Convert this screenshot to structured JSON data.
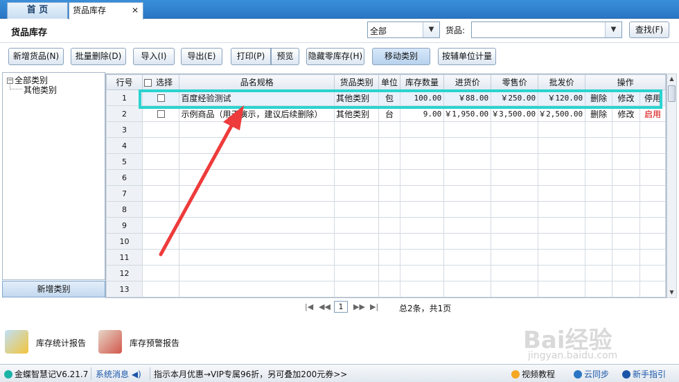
{
  "tabs": {
    "home": "首 页",
    "active": "货品库存",
    "close": "✕"
  },
  "header": {
    "title": "货品库存",
    "category_select": "全部",
    "goods_label": "货品:",
    "goods_value": "",
    "find_button": "查找(F)"
  },
  "toolbar": {
    "add_goods": "新增货品(N)",
    "batch_delete": "批量删除(D)",
    "import": "导入(I)",
    "export": "导出(E)",
    "print": "打印(P)",
    "preview": "预览",
    "hide_zero": "隐藏零库存(H)",
    "move_category": "移动类别",
    "aux_unit": "按辅单位计量"
  },
  "tree": {
    "root": "全部类别",
    "child": "其他类别",
    "add_category_button": "新增类别"
  },
  "grid": {
    "columns": [
      "行号",
      "选择",
      "品名规格",
      "货品类别",
      "单位",
      "库存数量",
      "进货价",
      "零售价",
      "批发价",
      "操作"
    ],
    "rows": [
      {
        "no": "1",
        "name": "百度经验测试",
        "category": "其他类别",
        "unit": "包",
        "qty": "100.00",
        "buy": "￥88.00",
        "retail": "￥250.00",
        "wholesale": "￥120.00",
        "op1": "删除",
        "op2": "修改",
        "op3": "停用",
        "op3_red": false
      },
      {
        "no": "2",
        "name": "示例商品（用于演示，建议后续删除）",
        "category": "其他类别",
        "unit": "台",
        "qty": "9.00",
        "buy": "￥1,950.00",
        "retail": "￥3,500.00",
        "wholesale": "￥2,500.00",
        "op1": "删除",
        "op2": "修改",
        "op3": "启用",
        "op3_red": true
      },
      {
        "no": "3"
      },
      {
        "no": "4"
      },
      {
        "no": "5"
      },
      {
        "no": "6"
      },
      {
        "no": "7"
      },
      {
        "no": "8"
      },
      {
        "no": "9"
      },
      {
        "no": "10"
      },
      {
        "no": "11"
      },
      {
        "no": "12"
      },
      {
        "no": "13"
      }
    ]
  },
  "pager": {
    "page": "1",
    "summary": "总2条，共1页"
  },
  "reports": {
    "stats": "库存统计报告",
    "warning": "库存预警报告"
  },
  "watermark": {
    "brand": "Bai经验",
    "url": "jingyan.baidu.com"
  },
  "status": {
    "app": "金蝶智慧记V6.21.7",
    "messages": "系统消息",
    "promo": "指示本月优惠→VIP专属96折，另可叠加200元券>>",
    "video": "视频教程",
    "sync": "云同步",
    "guide": "新手指引"
  },
  "colors": {
    "highlight": "#2bd3cf",
    "arrow": "#ee3b3b",
    "red_text": "#d40000",
    "link_blue": "#1a56a8"
  }
}
